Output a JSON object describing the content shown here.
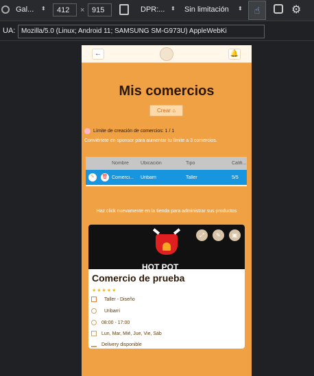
{
  "devtools": {
    "device": "Gal...",
    "width": "412",
    "times": "×",
    "height": "915",
    "dpr": "DPR:...",
    "throttle": "Sin limitación",
    "ua_label": "UA:",
    "ua_value": "Mozilla/5.0 (Linux; Android 11; SAMSUNG SM-G973U) AppleWebKi"
  },
  "app": {
    "page_title": "Mis comercios",
    "create_label": "Crear",
    "limit_text": "Límite de creación de comercios: 1 / 1",
    "sponsor_text": "Conviértete en sponsor para aumentar tu límite a 3 comercios.",
    "table": {
      "headers": [
        "Nombre",
        "Ubicación",
        "Tipo",
        "Califi..."
      ],
      "row": [
        "Comerci...",
        "Uribarri",
        "Taller",
        "5/5"
      ]
    },
    "hint_text": "Haz click nuevamente en la tienda para administrar sus productos",
    "card": {
      "title": "Comercio de prueba",
      "image_caption": "HOT POT",
      "stars": "★★★★★",
      "category": "Taller - Diseño",
      "location": "Uribarri",
      "hours": "08:00 - 17:00",
      "days": "Lun, Mar, Mié, Jue, Vie, Sáb",
      "delivery": "Delivery disponible"
    }
  }
}
